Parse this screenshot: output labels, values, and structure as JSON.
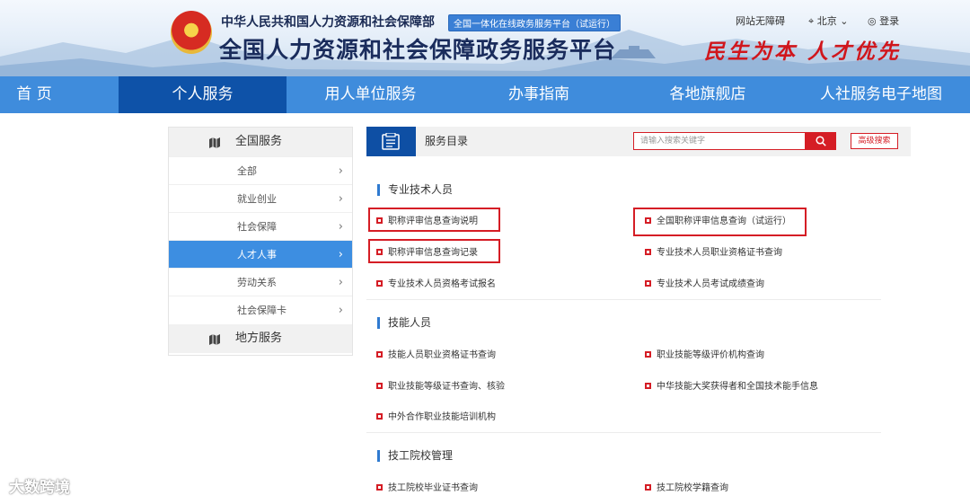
{
  "header": {
    "emblem_label": "国徽",
    "ministry": "中华人民共和国人力资源和社会保障部",
    "platform_tag": "全国一体化在线政务服务平台（试运行）",
    "site_title": "全国人力资源和社会保障政务服务平台",
    "accessible": "网站无障碍",
    "city": "北京",
    "login": "登录",
    "slogan": "民生为本 人才优先"
  },
  "nav": {
    "items": [
      "首 页",
      "个人服务",
      "用人单位服务",
      "办事指南",
      "各地旗舰店",
      "人社服务电子地图"
    ],
    "active": "个人服务"
  },
  "sidebar": {
    "national": "全国服务",
    "items": [
      "全部",
      "就业创业",
      "社会保障",
      "人才人事",
      "劳动关系",
      "社会保障卡"
    ],
    "active": "人才人事",
    "local": "地方服务"
  },
  "main": {
    "title": "服务目录",
    "search_placeholder": "请输入搜索关键字",
    "advanced": "高级搜索",
    "sections": [
      {
        "title": "专业技术人员",
        "items": [
          "职称评审信息查询说明",
          "全国职称评审信息查询（试运行）",
          "职称评审信息查询记录",
          "专业技术人员职业资格证书查询",
          "专业技术人员资格考试报名",
          "专业技术人员考试成绩查询"
        ]
      },
      {
        "title": "技能人员",
        "items": [
          "技能人员职业资格证书查询",
          "职业技能等级评价机构查询",
          "职业技能等级证书查询、核验",
          "中华技能大奖获得者和全国技术能手信息",
          "中外合作职业技能培训机构"
        ]
      },
      {
        "title": "技工院校管理",
        "items": [
          "技工院校毕业证书查询",
          "技工院校学籍查询"
        ]
      }
    ]
  },
  "watermark": "大数跨境",
  "colors": {
    "nav": "#3f8cdc",
    "nav_active": "#0e52a8",
    "accent_red": "#d51d25",
    "side_active": "#3d8ee1"
  }
}
